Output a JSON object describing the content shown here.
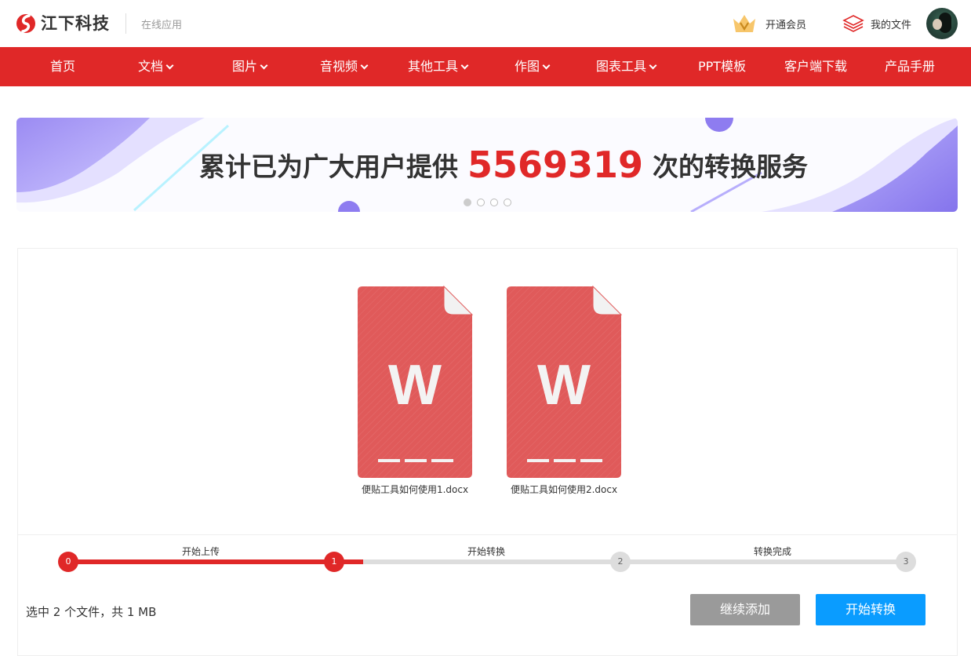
{
  "brand": {
    "name": "江下科技",
    "subtitle": "在线应用"
  },
  "header": {
    "vip_label": "开通会员",
    "myfiles_label": "我的文件"
  },
  "nav": {
    "items": [
      {
        "label": "首页",
        "dropdown": false
      },
      {
        "label": "文档",
        "dropdown": true
      },
      {
        "label": "图片",
        "dropdown": true
      },
      {
        "label": "音视频",
        "dropdown": true
      },
      {
        "label": "其他工具",
        "dropdown": true
      },
      {
        "label": "作图",
        "dropdown": true
      },
      {
        "label": "图表工具",
        "dropdown": true
      },
      {
        "label": "PPT模板",
        "dropdown": false
      },
      {
        "label": "客户端下载",
        "dropdown": false
      },
      {
        "label": "产品手册",
        "dropdown": false
      }
    ]
  },
  "banner": {
    "prefix": "累计已为广大用户提供",
    "count": "5569319",
    "suffix": "次的转换服务",
    "slides": 4,
    "active_slide": 1
  },
  "files": [
    {
      "name": "便贴工具如何使用1.docx",
      "icon": "word-doc-icon",
      "letter": "W"
    },
    {
      "name": "便贴工具如何使用2.docx",
      "icon": "word-doc-icon",
      "letter": "W"
    }
  ],
  "steps": {
    "nodes": [
      "0",
      "1",
      "2",
      "3"
    ],
    "labels": [
      "开始上传",
      "开始转换",
      "转换完成"
    ],
    "current": 1
  },
  "footer": {
    "summary": "选中 2 个文件，共 1 MB",
    "continue_label": "继续添加",
    "start_label": "开始转换"
  },
  "colors": {
    "brand_red": "#e02828",
    "primary_blue": "#0a9cff",
    "doc_red": "#e05a5a"
  }
}
